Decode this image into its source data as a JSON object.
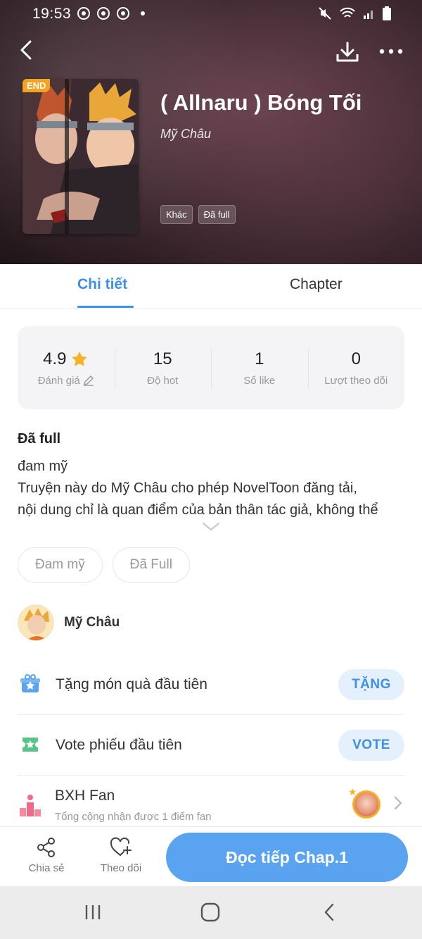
{
  "status_bar": {
    "time": "19:53"
  },
  "book": {
    "title": "( Allnaru ) Bóng Tối",
    "author": "Mỹ Châu",
    "end_badge": "END",
    "tags": [
      "Khác",
      "Đã full"
    ]
  },
  "tabs": {
    "details": "Chi tiết",
    "chapter": "Chapter"
  },
  "stats": {
    "rating": {
      "value": "4.9",
      "label": "Đánh giá"
    },
    "hot": {
      "value": "15",
      "label": "Độ hot"
    },
    "likes": {
      "value": "1",
      "label": "Số like"
    },
    "follows": {
      "value": "0",
      "label": "Lượt theo dõi"
    }
  },
  "description": {
    "status": "Đã full",
    "lines": [
      "đam mỹ",
      "Truyện này do Mỹ Châu cho phép NovelToon đăng tải,",
      "nội dung chỉ là quan điểm của bản thân tác giả, không thể"
    ]
  },
  "keywords": [
    "Đam mỹ",
    "Đã Full"
  ],
  "author_row": {
    "name": "Mỹ Châu"
  },
  "gift_row": {
    "label": "Tặng món quà đầu tiên",
    "button": "TẶNG"
  },
  "vote_row": {
    "label": "Vote phiếu đầu tiên",
    "button": "VOTE"
  },
  "fan_row": {
    "title": "BXH Fan",
    "subtitle": "Tổng cộng nhận được 1 điểm fan"
  },
  "bottom_bar": {
    "share": "Chia sẻ",
    "follow": "Theo dõi",
    "read": "Đọc tiếp Chap.1"
  },
  "colors": {
    "accent": "#3d8fe8",
    "read_button": "#5aa3f0",
    "end_badge": "#f3a321",
    "star": "#f5b428"
  }
}
